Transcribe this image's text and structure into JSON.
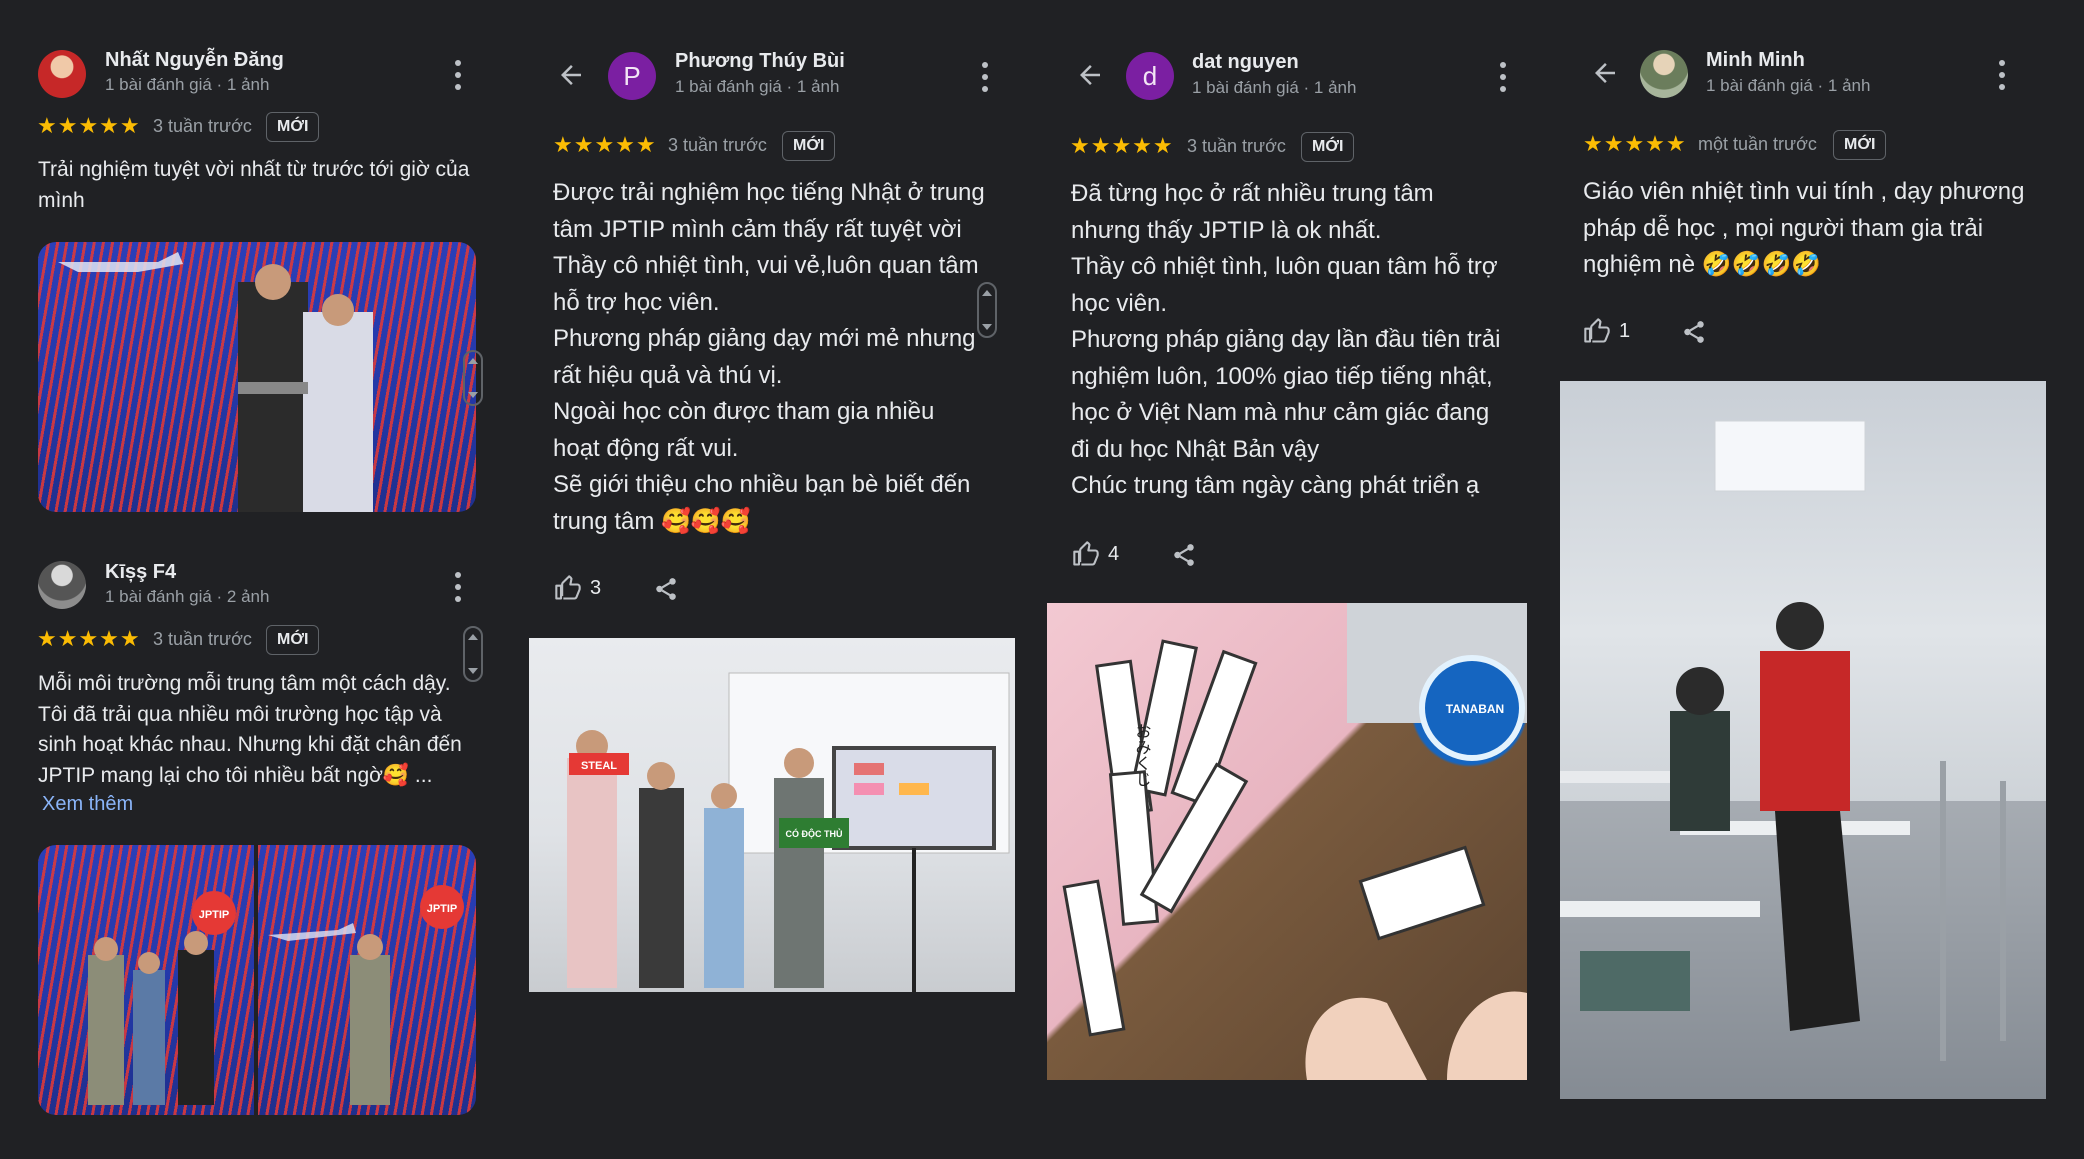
{
  "reviews": [
    {
      "name": "Nhất Nguyễn Đăng",
      "meta": "1 bài đánh giá · 1 ảnh",
      "stars": "★★★★★",
      "time": "3 tuần trước",
      "badge": "MỚI",
      "text": "Trải nghiệm tuyệt vời nhất từ trước tới giờ của\nmình"
    },
    {
      "name": "Kīșş F4",
      "meta": "1 bài đánh giá · 2 ảnh",
      "stars": "★★★★★",
      "time": "3 tuần trước",
      "badge": "MỚI",
      "text": "Mỗi môi trường mỗi trung tâm một cách dậy.\nTôi đã trải qua nhiều môi trường học tập và\nsinh hoạt khác nhau. Nhưng khi đặt chân đến\nJPTIP mang lại cho tôi nhiều bất ngờ🥰 ...",
      "more": "Xem thêm"
    },
    {
      "avatar_letter": "P",
      "name": "Phương Thúy Bùi",
      "meta": "1 bài đánh giá · 1 ảnh",
      "stars": "★★★★★",
      "time": "3 tuần trước",
      "badge": "MỚI",
      "text": "Được trải nghiệm học tiếng Nhật ở trung\ntâm JPTIP mình cảm thấy rất tuyệt vời\nThầy cô nhiệt tình, vui vẻ,luôn quan tâm\nhỗ trợ học viên.\nPhương pháp giảng dạy mới mẻ nhưng\nrất hiệu quả và thú vị.\nNgoài học còn được tham gia nhiều\nhoạt động rất vui.\nSẽ giới thiệu cho nhiều bạn bè biết đến\ntrung tâm 🥰🥰🥰",
      "likes": "3"
    },
    {
      "avatar_letter": "d",
      "name": "dat nguyen",
      "meta": "1 bài đánh giá · 1 ảnh",
      "stars": "★★★★★",
      "time": "3 tuần trước",
      "badge": "MỚI",
      "text": "Đã từng học ở rất nhiều trung tâm\nnhưng thấy JPTIP là ok nhất.\nThầy cô nhiệt tình, luôn quan tâm hỗ trợ\nhọc viên.\nPhương pháp giảng dạy lần đầu tiên trải\nnghiệm luôn, 100% giao tiếp tiếng nhật,\nhọc ở Việt Nam mà như cảm giác đang\nđi du học Nhật Bản vậy\nChúc trung tâm ngày càng phát triển ạ",
      "likes": "4"
    },
    {
      "name": "Minh Minh",
      "meta": "1 bài đánh giá · 1 ảnh",
      "stars": "★★★★★",
      "time": "một tuần trước",
      "badge": "MỚI",
      "text": "Giáo viên nhiệt tình vui tính , dạy phương\npháp dễ học , mọi người tham gia trải\nnghiệm nè 🤣🤣🤣🤣",
      "likes": "1"
    }
  ],
  "photo_text": {
    "jptip_logo": "JPTIP",
    "sign_1": "STEAL",
    "sign_2": "CÓ ĐỘC THỦ",
    "tin_label": "TANABAN",
    "omikuji": "おみくじ"
  },
  "icons": {
    "back": "arrow-left-icon",
    "menu": "more-vert-icon",
    "like": "thumb-up-icon",
    "share": "share-icon"
  },
  "colors": {
    "background": "#202124",
    "star": "#fbbc04",
    "link": "#8ab4f8",
    "avatar_letter_bg": "#7b1fa2"
  }
}
